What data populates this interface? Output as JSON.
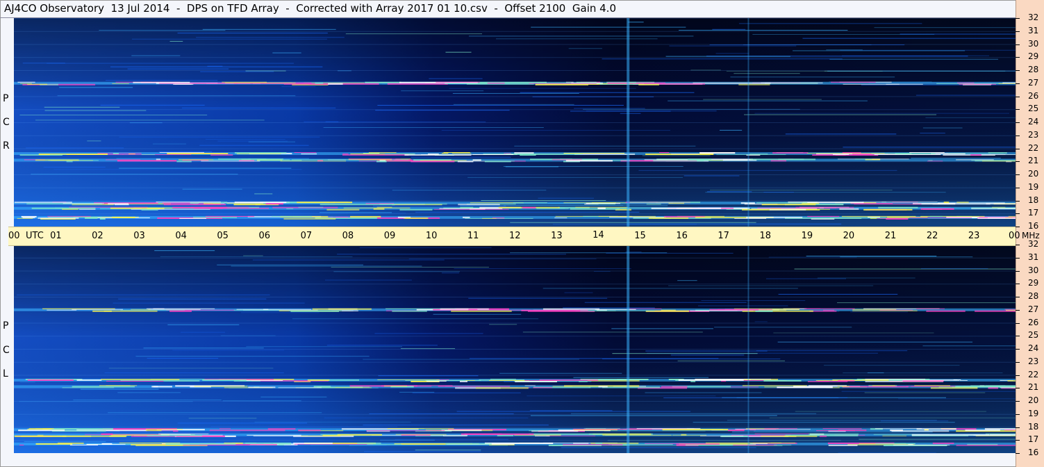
{
  "title": "AJ4CO Observatory  13 Jul 2014  -  DPS on TFD Array  -  Corrected with Array 2017 01 10.csv  -  Offset 2100  Gain 4.0",
  "chart_data": [
    {
      "type": "heatmap",
      "panel": "RCP",
      "panel_label": [
        "R",
        "C",
        "P"
      ],
      "xlabel": "UTC",
      "x_ticks": [
        "00",
        "01",
        "02",
        "03",
        "04",
        "05",
        "06",
        "07",
        "08",
        "09",
        "10",
        "11",
        "12",
        "13",
        "14",
        "15",
        "16",
        "17",
        "18",
        "19",
        "20",
        "21",
        "22",
        "23",
        "00"
      ],
      "y_unit": "MHz",
      "y_ticks": [
        16,
        17,
        18,
        19,
        20,
        21,
        22,
        23,
        24,
        25,
        26,
        27,
        28,
        29,
        30,
        31,
        32
      ],
      "xlim": [
        0,
        24
      ],
      "ylim": [
        16,
        32
      ],
      "features": {
        "bright_bands_mhz": [
          16.7,
          17.4,
          17.8,
          21.1,
          21.6,
          27.0
        ],
        "vertical_stripes_utc": [
          14.7,
          17.6
        ]
      }
    },
    {
      "type": "heatmap",
      "panel": "LCP",
      "panel_label": [
        "L",
        "C",
        "P"
      ],
      "xlabel": "UTC",
      "x_ticks": [
        "00",
        "01",
        "02",
        "03",
        "04",
        "05",
        "06",
        "07",
        "08",
        "09",
        "10",
        "11",
        "12",
        "13",
        "14",
        "15",
        "16",
        "17",
        "18",
        "19",
        "20",
        "21",
        "22",
        "23",
        "00"
      ],
      "y_unit": "MHz",
      "y_ticks": [
        16,
        17,
        18,
        19,
        20,
        21,
        22,
        23,
        24,
        25,
        26,
        27,
        28,
        29,
        30,
        31,
        32
      ],
      "xlim": [
        0,
        24
      ],
      "ylim": [
        16,
        32
      ],
      "features": {
        "bright_bands_mhz": [
          16.7,
          17.4,
          17.8,
          21.1,
          21.6,
          27.0
        ],
        "vertical_stripes_utc": [
          14.7,
          17.6
        ]
      }
    }
  ],
  "palette": [
    "#000510",
    "#00135a",
    "#0030c0",
    "#1a6cff",
    "#39b2ff",
    "#7fe8c8",
    "#f5f050",
    "#ff40c0",
    "#ffffff"
  ]
}
